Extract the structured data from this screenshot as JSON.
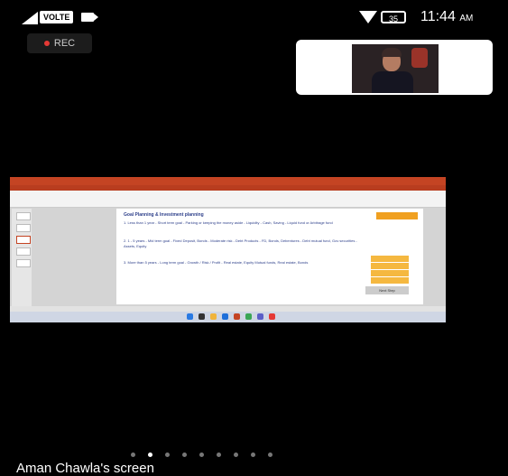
{
  "status_bar": {
    "network_label": "VOLTE",
    "battery_label": "35",
    "time": "11:44",
    "time_suffix": "AM"
  },
  "recording": {
    "label": "REC",
    "indicator_color": "#e53935"
  },
  "pip": {
    "participant": "video-feed"
  },
  "shared_screen": {
    "app": "PowerPoint",
    "accent_color": "#c44423",
    "slide": {
      "title": "Goal Planning & Investment planning",
      "paragraphs": [
        "1. Less than 1 year - Short term goal - Parking or keeping the money aside - Liquidity - Cash, Saving - Liquid fund or Arbitrage fund",
        "2. 1 - 5 years - Mid term goal - Fixed Deposit, Bonds - Moderate risk - Debt Products - FD, Bonds, Debentures - Debt mutual fund, Gov securities - Assets, Equity",
        "3. More than 5 years - Long term goal - Growth / Risk / Profit - Real estate, Equity Mutual funds, Real estate, Bonds"
      ],
      "button_label": "Next Step"
    }
  },
  "pager": {
    "count": 9,
    "active_index": 1
  },
  "caption": "Aman Chawla's screen"
}
